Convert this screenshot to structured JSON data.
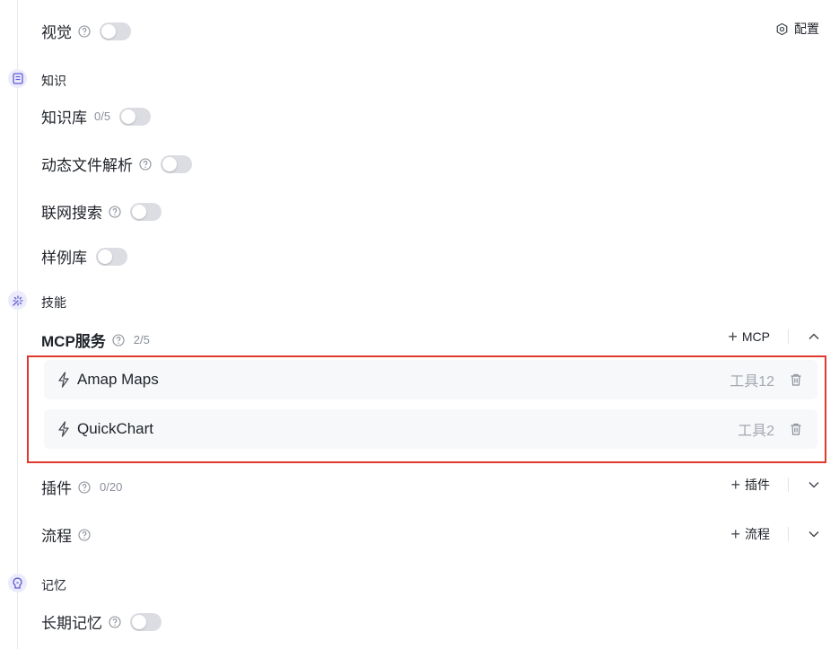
{
  "vision": {
    "label": "视觉",
    "config_label": "配置"
  },
  "knowledge": {
    "section_label": "知识",
    "items": [
      {
        "label": "知识库",
        "count": "0/5"
      },
      {
        "label": "动态文件解析"
      },
      {
        "label": "联网搜索"
      },
      {
        "label": "样例库"
      }
    ]
  },
  "skills": {
    "section_label": "技能",
    "mcp": {
      "label": "MCP服务",
      "count": "2/5",
      "add_label": "MCP",
      "services": [
        {
          "name": "Amap Maps",
          "tools": "工具12"
        },
        {
          "name": "QuickChart",
          "tools": "工具2"
        }
      ]
    },
    "plugins": {
      "label": "插件",
      "count": "0/20",
      "add_label": "插件"
    },
    "workflow": {
      "label": "流程",
      "add_label": "流程"
    }
  },
  "memory": {
    "section_label": "记忆",
    "items": [
      {
        "label": "长期记忆"
      }
    ]
  },
  "colors": {
    "accent_highlight": "#e0392b",
    "toggle_off": "#dcdde3",
    "section_icon_bg": "#ecebfb"
  }
}
